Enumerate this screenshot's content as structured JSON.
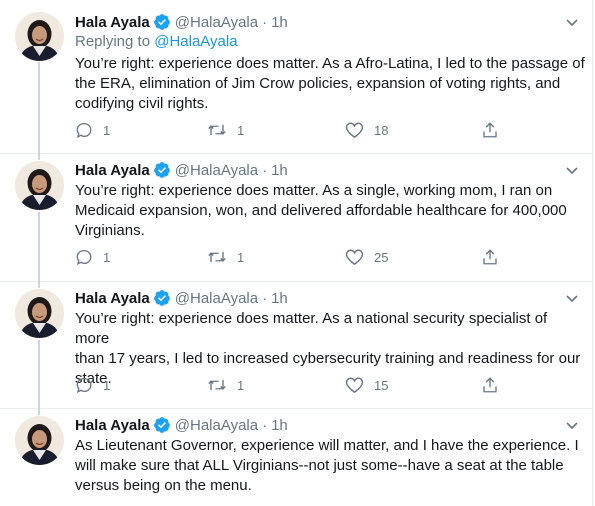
{
  "colors": {
    "text": "#14171a",
    "secondary": "#657786",
    "link": "#1b95e0",
    "verified": "#1da1f2",
    "divider": "#e6ecf0"
  },
  "icons": {
    "verified": "verified-badge-icon",
    "menu": "chevron-down-icon",
    "reply": "reply-icon",
    "retweet": "retweet-icon",
    "like": "heart-icon",
    "share": "share-icon"
  },
  "tweets": [
    {
      "name": "Hala Ayala",
      "handle": "@HalaAyala",
      "separator": "·",
      "time": "1h",
      "replying_prefix": "Replying to ",
      "replying_to": "@HalaAyala",
      "lines": [
        "You’re right: experience does matter. As a Afro-Latina, I led to the passage of",
        "the ERA, elimination of Jim Crow policies, expansion of voting rights, and",
        "codifying civil rights."
      ],
      "replies": "1",
      "retweets": "1",
      "likes": "18"
    },
    {
      "name": "Hala Ayala",
      "handle": "@HalaAyala",
      "separator": "·",
      "time": "1h",
      "lines": [
        "You’re right: experience does matter. As a single, working mom, I ran on",
        "Medicaid expansion, won, and delivered affordable healthcare for 400,000",
        "Virginians."
      ],
      "replies": "1",
      "retweets": "1",
      "likes": "25"
    },
    {
      "name": "Hala Ayala",
      "handle": "@HalaAyala",
      "separator": "·",
      "time": "1h",
      "lines": [
        "You’re right: experience does matter. As a national security specialist of more",
        "than 17 years, I led to increased cybersecurity training and readiness for our",
        "state."
      ],
      "replies": "1",
      "retweets": "1",
      "likes": "15"
    },
    {
      "name": "Hala Ayala",
      "handle": "@HalaAyala",
      "separator": "·",
      "time": "1h",
      "lines": [
        "As Lieutenant Governor, experience will matter, and I have the experience. I",
        "will make sure that ALL Virginians--not just some--have a seat at the table",
        "versus being on the menu."
      ]
    }
  ]
}
